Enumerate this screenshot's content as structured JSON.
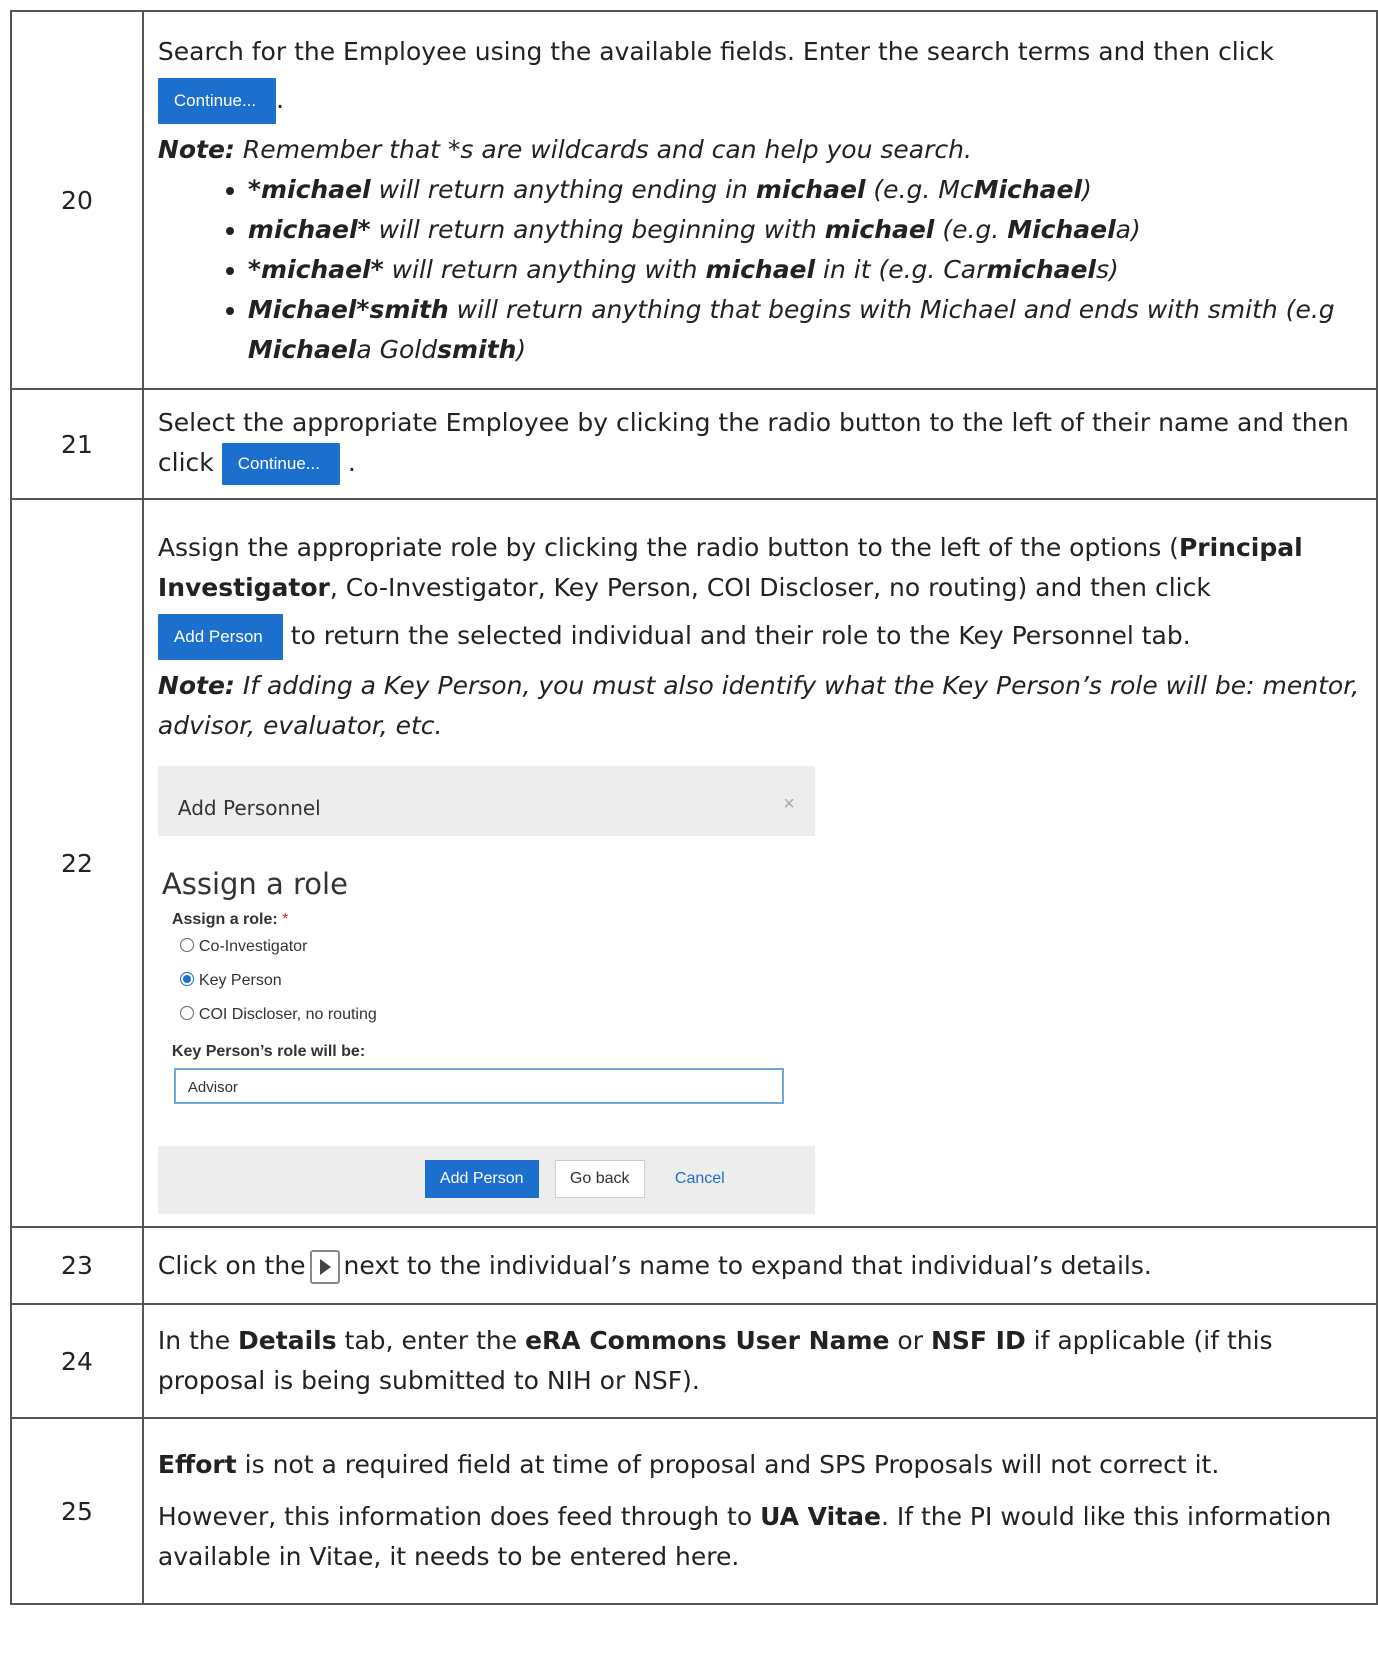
{
  "rows": [
    {
      "num": "20",
      "p1": "Search for the Employee using the available fields. Enter the search terms and then click",
      "button": "Continue...",
      "after_button": ".",
      "note_label": "Note:",
      "note_text": " Remember that *s are wildcards and can help you search.",
      "bullets": [
        {
          "b": "*michael",
          "t1": " will return anything ending in ",
          "b2": "michael",
          "t2": " (e.g. Mc",
          "b3": "Michael",
          "t3": ")"
        },
        {
          "b": "michael*",
          "t1": " will return anything beginning with ",
          "b2": "michael",
          "t2": " (e.g. ",
          "b3": "Michael",
          "t3": "a)"
        },
        {
          "b": "*michael*",
          "t1": " will return anything with ",
          "b2": "michael",
          "t2": " in it (e.g. Car",
          "b3": "michael",
          "t3": "s)"
        },
        {
          "b": "Michael*smith",
          "t1": " will return anything that begins with Michael and ends with smith (e.g ",
          "b2": "Michael",
          "t2": "a Gold",
          "b3": "smith",
          "t3": ")"
        }
      ]
    },
    {
      "num": "21",
      "p1": "Select the appropriate Employee by clicking the radio button to the left of their name and then click",
      "button": "Continue...",
      "after_button": "."
    },
    {
      "num": "22",
      "p1a": "Assign the appropriate role by clicking the radio button to the left of the options (",
      "p1b": "Principal Investigator",
      "p1c": ", Co-Investigator, Key Person, COI Discloser, no routing) and then click",
      "button": "Add Person",
      "after_button": " to return the selected individual and their role to the Key Personnel tab.",
      "note_label": "Note:",
      "note_text": " If adding a Key Person, you must also identify what the Key Person’s role will be: mentor, advisor, evaluator, etc.",
      "dialog": {
        "title": "Add Personnel",
        "close": "×",
        "heading": "Assign a role",
        "role_label": "Assign a role:",
        "required": "*",
        "options": [
          "Co-Investigator",
          "Key Person",
          "COI Discloser, no routing"
        ],
        "selected": "Key Person",
        "kp_label": "Key Person’s role will be:",
        "kp_value": "Advisor",
        "add_button": "Add Person",
        "back_button": "Go back",
        "cancel_link": "Cancel"
      }
    },
    {
      "num": "23",
      "t1": "Click on the",
      "icon": "expand-arrow-icon",
      "t2": "next to the individual’s name to expand that individual’s details."
    },
    {
      "num": "24",
      "t1": "In the ",
      "b1": "Details",
      "t2": " tab, enter the ",
      "b2": "eRA Commons User Name",
      "t3": " or ",
      "b3": "NSF ID",
      "t4": " if applicable (if this proposal is being submitted to NIH or NSF)."
    },
    {
      "num": "25",
      "b1": "Effort",
      "t1": " is not a required field at time of proposal and SPS Proposals will not correct it.",
      "t2": "However, this information does feed through to ",
      "b2": "UA Vitae",
      "t3": ". If the PI would like this information available in Vitae, it needs to be entered here."
    }
  ],
  "colors": {
    "button_blue": "#1d6fce",
    "border": "#555555"
  }
}
